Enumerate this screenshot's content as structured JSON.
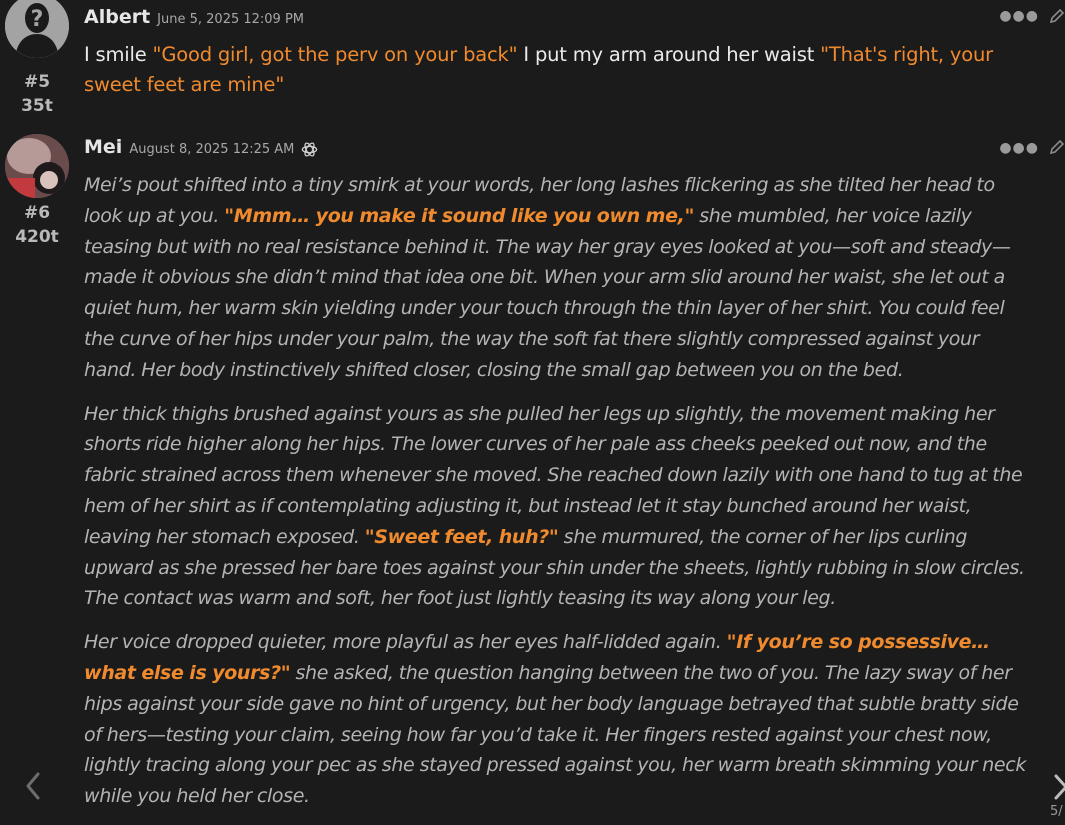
{
  "messages": [
    {
      "author": "Albert",
      "date": "June 5, 2025 12:09 PM",
      "index": "#5",
      "tokens": "35t",
      "text_parts": [
        "I smile ",
        "\"Good girl, got the perv on your back\"",
        " I put my arm around her waist ",
        "\"That's right, your sweet feet are mine\""
      ]
    },
    {
      "author": "Mei",
      "date": "August 8, 2025 12:25 AM",
      "index": "#6",
      "tokens": "420t",
      "paragraphs": [
        [
          "Mei’s pout shifted into a tiny smirk at your words, her long lashes flickering as she tilted her head to look up at you. ",
          "\"Mmm… you make it sound like you own me,\"",
          " she mumbled, her voice lazily teasing but with no real resistance behind it. The way her gray eyes looked at you—soft and steady—made it obvious she didn’t mind that idea one bit. When your arm slid around her waist, she let out a quiet hum, her warm skin yielding under your touch through the thin layer of her shirt. You could feel the curve of her hips under your palm, the way the soft fat there slightly compressed against your hand. Her body instinctively shifted closer, closing the small gap between you on the bed."
        ],
        [
          "Her thick thighs brushed against yours as she pulled her legs up slightly, the movement making her shorts ride higher along her hips. The lower curves of her pale ass cheeks peeked out now, and the fabric strained across them whenever she moved. She reached down lazily with one hand to tug at the hem of her shirt as if contemplating adjusting it, but instead let it stay bunched around her waist, leaving her stomach exposed. ",
          "\"Sweet feet, huh?\"",
          " she murmured, the corner of her lips curling upward as she pressed her bare toes against your shin under the sheets, lightly rubbing in slow circles. The contact was warm and soft, her foot just lightly teasing its way along your leg."
        ],
        [
          "Her voice dropped quieter, more playful as her eyes half-lidded again. ",
          "\"If you’re so possessive… what else is yours?\"",
          " she asked, the question hanging between the two of you. The lazy sway of her hips against your side gave no hint of urgency, but her body language betrayed that subtle bratty side of hers—testing your claim, seeing how far you’d take it. Her fingers rested against your chest now, lightly tracing along your pec as she stayed pressed against you, her warm breath skimming your neck while you held her close."
        ]
      ]
    }
  ],
  "page_counter": "5/",
  "icons": {
    "more": "more-options-icon",
    "edit": "edit-pencil-icon",
    "model": "openai-logo-icon",
    "prev": "chevron-left-icon",
    "next": "chevron-right-icon"
  },
  "colors": {
    "background": "#1b1b1b",
    "quote": "#ef8a2e",
    "narration": "#b4b4b4"
  }
}
